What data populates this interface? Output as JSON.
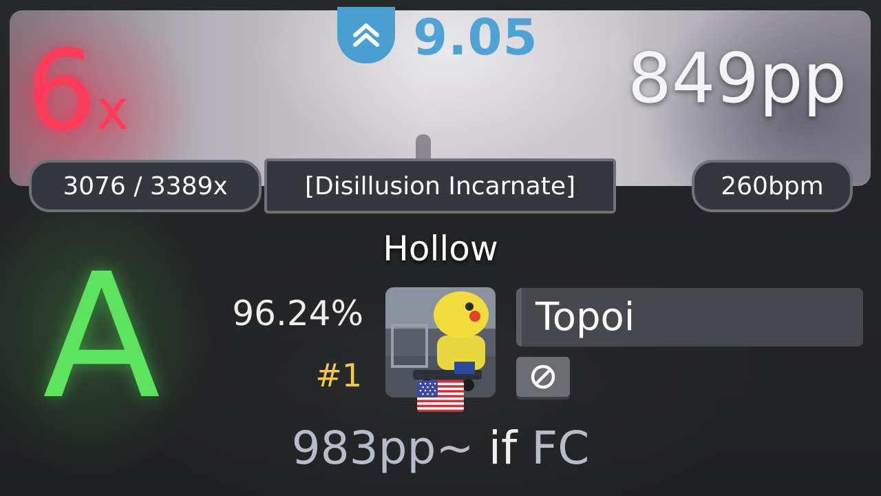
{
  "header": {
    "combo_multiplier": "6",
    "combo_suffix": "x",
    "star_rating": "9.05",
    "pp": "849pp"
  },
  "info_pills": {
    "combo": "3076 / 3389x",
    "difficulty": "[Disillusion Incarnate]",
    "bpm": "260bpm"
  },
  "song": {
    "title": "Hollow"
  },
  "score": {
    "grade": "A",
    "accuracy": "96.24%",
    "rank": "#1"
  },
  "player": {
    "name": "Topoi",
    "country_flag": "us-flag-icon",
    "mod_icon": "no-fail-icon"
  },
  "footer": {
    "pp_if_fc_value": "983pp~",
    "pp_if_fc_word": "if",
    "pp_if_fc_label": "FC"
  },
  "colors": {
    "combo": "#ff3b5c",
    "star_rating": "#4ea3d4",
    "grade": "#5ee35e",
    "rank": "#f2c94c"
  }
}
